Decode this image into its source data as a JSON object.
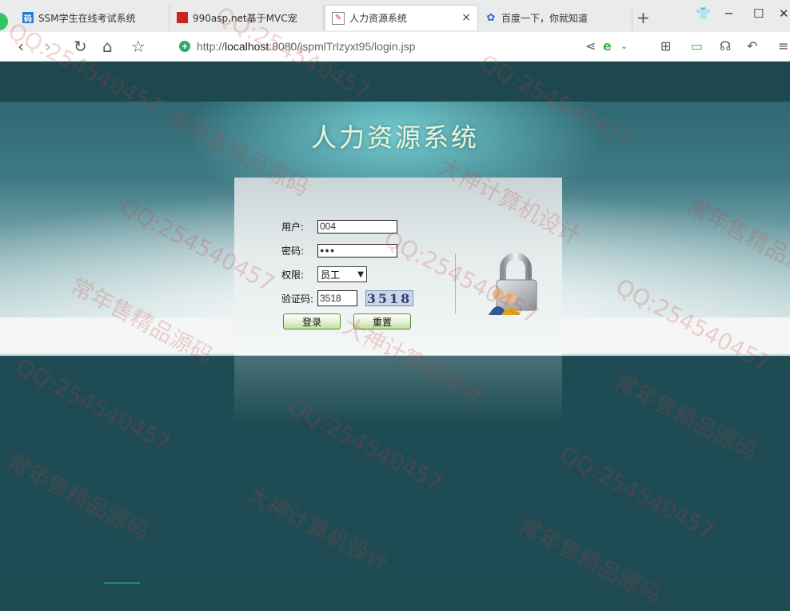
{
  "browser": {
    "tabs": [
      {
        "label": "SSM学生在线考试系统",
        "favicon": "code-favicon",
        "active": false
      },
      {
        "label": "990asp.net基于MVC宠",
        "favicon": "red-square-favicon",
        "active": false
      },
      {
        "label": "人力资源系统",
        "favicon": "page-favicon",
        "active": true
      },
      {
        "label": "百度一下，你就知道",
        "favicon": "baidu-paw-favicon",
        "active": false
      }
    ],
    "close_glyph": "×",
    "new_tab_glyph": "+",
    "url_prefix": "http://",
    "url_host": "localhost",
    "url_rest": ":8080/jspmlTrlzyxt95/login.jsp"
  },
  "page": {
    "title": "人力资源系统",
    "form": {
      "user_label": "用户:",
      "user_value": "004",
      "password_label": "密码:",
      "password_mask": "●●●",
      "role_label": "权限:",
      "role_value": "员工",
      "captcha_label": "验证码:",
      "captcha_value": "3518",
      "captcha_image_text": "3518",
      "login_button": "登录",
      "reset_button": "重置"
    }
  },
  "watermark": {
    "lines": [
      "QQ:254540457",
      "常年售精品源码",
      "大神计算机设计"
    ]
  },
  "colors": {
    "page_bg": "#1f4c54",
    "title": "#eaf6d8",
    "button_green": "#bfe09a",
    "watermark": "#c83c3c"
  }
}
